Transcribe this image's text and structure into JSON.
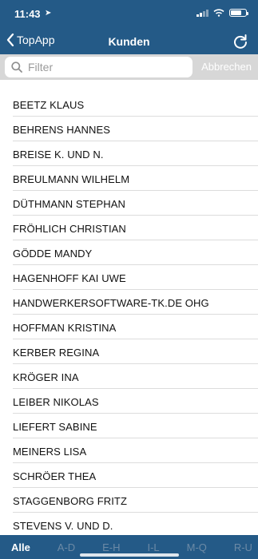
{
  "status_bar": {
    "time": "11:43",
    "location_icon": "location-arrow-icon"
  },
  "header": {
    "back_label": "TopApp",
    "title": "Kunden",
    "refresh_icon": "refresh-icon"
  },
  "search": {
    "placeholder": "Filter",
    "value": "",
    "cancel_label": "Abbrechen"
  },
  "customers": [
    "BEETZ KLAUS",
    "BEHRENS HANNES",
    "BREISE K. UND N.",
    "BREULMANN WILHELM",
    "DÜTHMANN STEPHAN",
    "FRÖHLICH CHRISTIAN",
    "GÖDDE MANDY",
    "HAGENHOFF KAI UWE",
    "HANDWERKERSOFTWARE-TK.DE OHG",
    "HOFFMAN KRISTINA",
    "KERBER REGINA",
    "KRÖGER INA",
    "LEIBER NIKOLAS",
    "LIEFERT SABINE",
    "MEINERS LISA",
    "SCHRÖER THEA",
    "STAGGENBORG FRITZ",
    "STEVENS V. UND D."
  ],
  "tabs": [
    "Alle",
    "A-D",
    "E-H",
    "I-L",
    "M-Q",
    "R-U"
  ],
  "colors": {
    "header": "#245a87",
    "tab_inactive": "#6c8aa6",
    "search_bg": "#d7d7d7"
  }
}
